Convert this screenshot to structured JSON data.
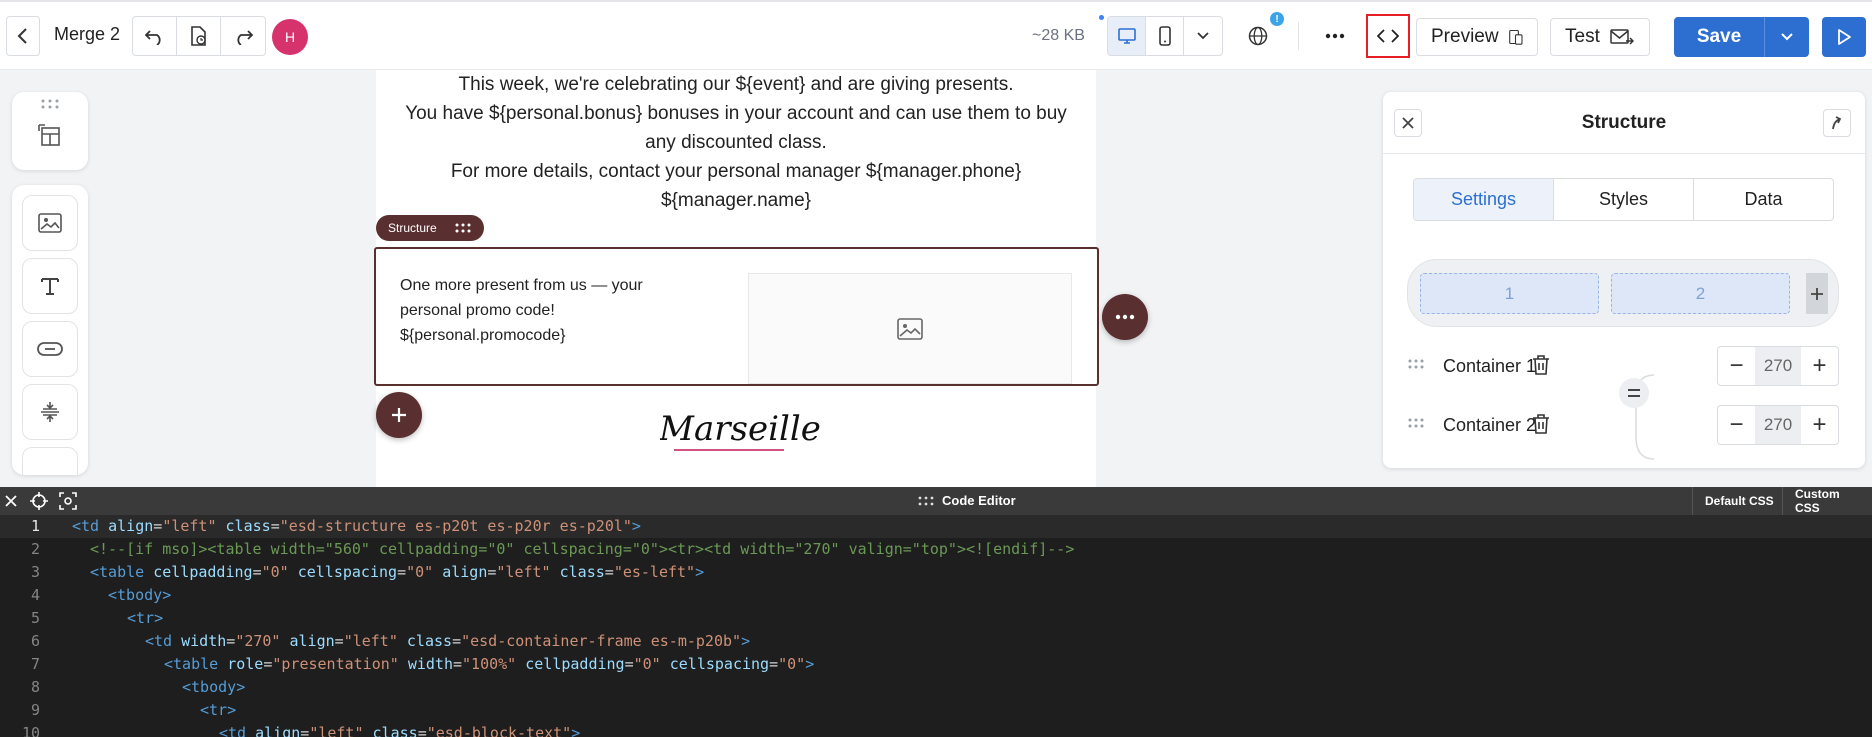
{
  "toolbar": {
    "doc_name": "Merge 2",
    "avatar_initial": "H",
    "size_label": "~28 KB",
    "preview_label": "Preview",
    "test_label": "Test",
    "save_label": "Save",
    "notify_badge": "!"
  },
  "email": {
    "lines": [
      "This week, we're celebrating our ${event} and are giving presents.",
      "You have ${personal.bonus} bonuses in your account and can use them to buy",
      "any discounted class.",
      "For more details, contact your personal manager ${manager.phone}",
      "${manager.name}"
    ],
    "structure_tag": "Structure",
    "promo_text": "One more present from us — your personal promo code! ${personal.promocode}",
    "footer_logo": "Marseille"
  },
  "panel": {
    "title": "Structure",
    "tabs": [
      {
        "label": "Settings",
        "active": true
      },
      {
        "label": "Styles",
        "active": false
      },
      {
        "label": "Data",
        "active": false
      }
    ],
    "columns": [
      "1",
      "2"
    ],
    "containers": [
      {
        "label": "Container 1",
        "width": "270"
      },
      {
        "label": "Container 2",
        "width": "270"
      }
    ]
  },
  "code_editor": {
    "title": "Code Editor",
    "default_css": "Default CSS",
    "custom_css": "Custom CSS",
    "lines": [
      "<td align=\"left\" class=\"esd-structure es-p20t es-p20r es-p20l\">",
      "<!--[if mso]><table width=\"560\" cellpadding=\"0\" cellspacing=\"0\"><tr><td width=\"270\" valign=\"top\"><![endif]-->",
      "<table cellpadding=\"0\" cellspacing=\"0\" align=\"left\" class=\"es-left\">",
      "<tbody>",
      "<tr>",
      "<td width=\"270\" align=\"left\" class=\"esd-container-frame es-m-p20b\">",
      "<table role=\"presentation\" width=\"100%\" cellpadding=\"0\" cellspacing=\"0\">",
      "<tbody>",
      "<tr>",
      "<td align=\"left\" class=\"esd-block-text\">"
    ]
  },
  "colors": {
    "accent": "#2c6fd1",
    "brand_dark": "#5a2f2f",
    "highlight": "#e81e25",
    "avatar": "#d6336c"
  }
}
